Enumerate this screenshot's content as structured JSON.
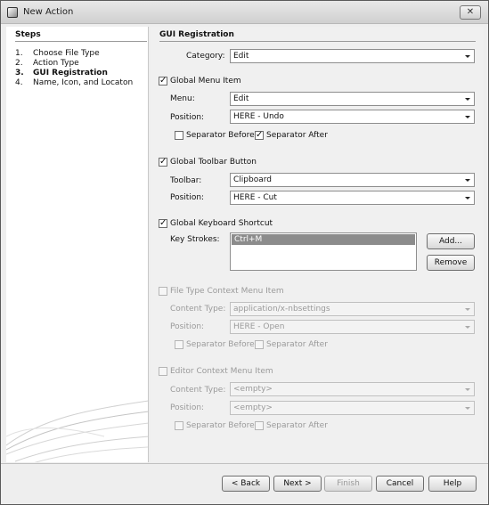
{
  "window": {
    "title": "New Action",
    "close_label": "✕"
  },
  "steps": {
    "title": "Steps",
    "items": [
      {
        "num": "1.",
        "label": "Choose File Type"
      },
      {
        "num": "2.",
        "label": "Action Type"
      },
      {
        "num": "3.",
        "label": "GUI Registration"
      },
      {
        "num": "4.",
        "label": "Name, Icon, and Locaton"
      }
    ]
  },
  "panel": {
    "title": "GUI Registration",
    "category": {
      "label": "Category:",
      "value": "Edit"
    },
    "global_menu": {
      "label": "Global Menu Item",
      "checked": "✓",
      "menu_label": "Menu:",
      "menu_value": "Edit",
      "position_label": "Position:",
      "position_value": "HERE - Undo",
      "separator_before": "Separator Before",
      "separator_after": "Separator After",
      "sep_before_checked": "",
      "sep_after_checked": "✓"
    },
    "global_toolbar": {
      "label": "Global Toolbar Button",
      "checked": "✓",
      "toolbar_label": "Toolbar:",
      "toolbar_value": "Clipboard",
      "position_label": "Position:",
      "position_value": "HERE - Cut"
    },
    "keyboard": {
      "label": "Global Keyboard Shortcut",
      "checked": "✓",
      "strokes_label": "Key Strokes:",
      "strokes": [
        "Ctrl+M"
      ],
      "add_label": "Add...",
      "remove_label": "Remove"
    },
    "file_type_context": {
      "label": "File Type Context Menu Item",
      "checked": "",
      "content_type_label": "Content Type:",
      "content_type_value": "application/x-nbsettings",
      "position_label": "Position:",
      "position_value": "HERE - Open",
      "separator_before": "Separator Before",
      "separator_after": "Separator After"
    },
    "editor_context": {
      "label": "Editor Context Menu Item",
      "checked": "",
      "content_type_label": "Content Type:",
      "content_type_value": "<empty>",
      "position_label": "Position:",
      "position_value": "<empty>",
      "separator_before": "Separator Before",
      "separator_after": "Separator After"
    }
  },
  "footer": {
    "back": "< Back",
    "next": "Next >",
    "finish": "Finish",
    "cancel": "Cancel",
    "help": "Help"
  }
}
